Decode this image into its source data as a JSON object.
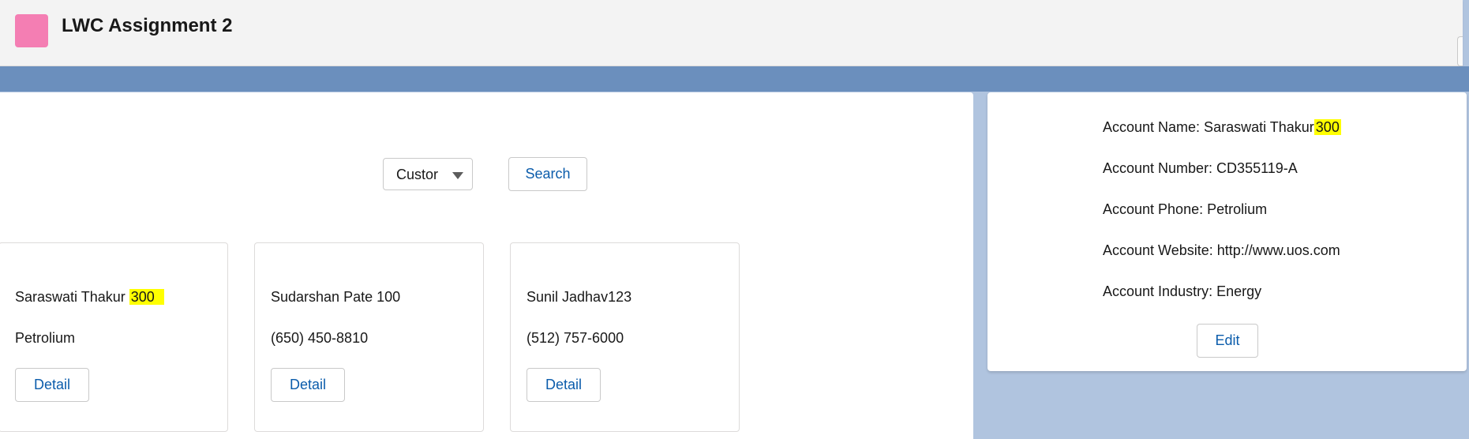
{
  "header": {
    "title": "LWC Assignment 2"
  },
  "filter": {
    "select_value": "Custor",
    "search_label": "Search"
  },
  "cards": [
    {
      "name": "Saraswati Thakur",
      "name_highlight": "300",
      "sub": "Petrolium",
      "button": "Detail"
    },
    {
      "name": "Sudarshan Pate 100",
      "sub": "(650) 450-8810",
      "button": "Detail"
    },
    {
      "name": "Sunil Jadhav123",
      "sub": "(512) 757-6000",
      "button": "Detail"
    }
  ],
  "details": {
    "name_label": "Account Name: Saraswati Thakur",
    "name_highlight": "300",
    "number": "Account Number: CD355119-A",
    "phone": "Account Phone: Petrolium",
    "website": "Account Website: http://www.uos.com",
    "industry": "Account Industry: Energy",
    "edit_label": "Edit"
  },
  "colors": {
    "app_icon": "#f47eb3",
    "link_blue": "#0b5cab",
    "highlight": "#ffff00",
    "background": "#b0c4df"
  }
}
